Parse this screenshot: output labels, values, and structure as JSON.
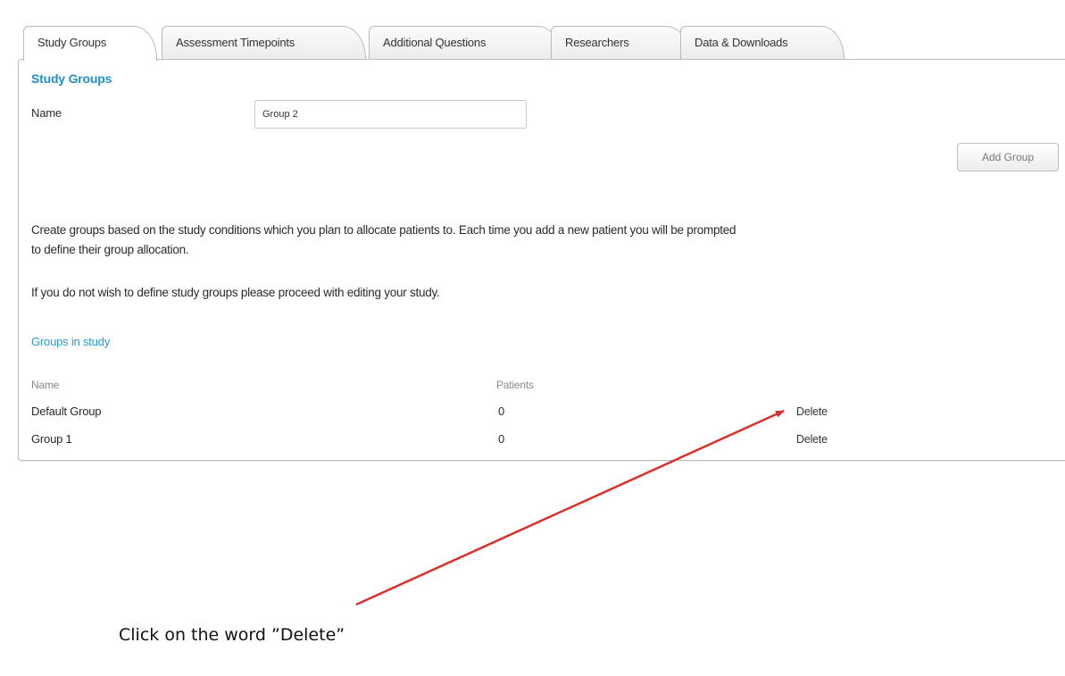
{
  "tabs": [
    {
      "label": "Study Groups",
      "active": true
    },
    {
      "label": "Assessment Timepoints",
      "active": false
    },
    {
      "label": "Additional Questions",
      "active": false
    },
    {
      "label": "Researchers",
      "active": false
    },
    {
      "label": "Data & Downloads",
      "active": false
    }
  ],
  "form": {
    "section_title": "Study Groups",
    "name_label": "Name",
    "name_value": "Group 2",
    "add_button_label": "Add Group"
  },
  "instructions": {
    "line1": "Create groups based on the study conditions which you plan to allocate patients to. Each time you add a new patient you will be prompted",
    "line2": "to define their group allocation.",
    "line3": "If you do not wish to define study groups please proceed with editing your study."
  },
  "groups": {
    "title": "Groups in study",
    "columns": {
      "name": "Name",
      "patients": "Patients"
    },
    "rows": [
      {
        "name": "Default Group",
        "patients": "0",
        "action": "Delete"
      },
      {
        "name": "Group 1",
        "patients": "0",
        "action": "Delete"
      }
    ]
  },
  "annotation": {
    "caption": "Click on the word ”Delete”",
    "arrow_color": "#d9302c"
  },
  "colors": {
    "section_title": "#1f8fc7",
    "subsection_title": "#2a9ad0",
    "border": "#bdbdbd"
  }
}
